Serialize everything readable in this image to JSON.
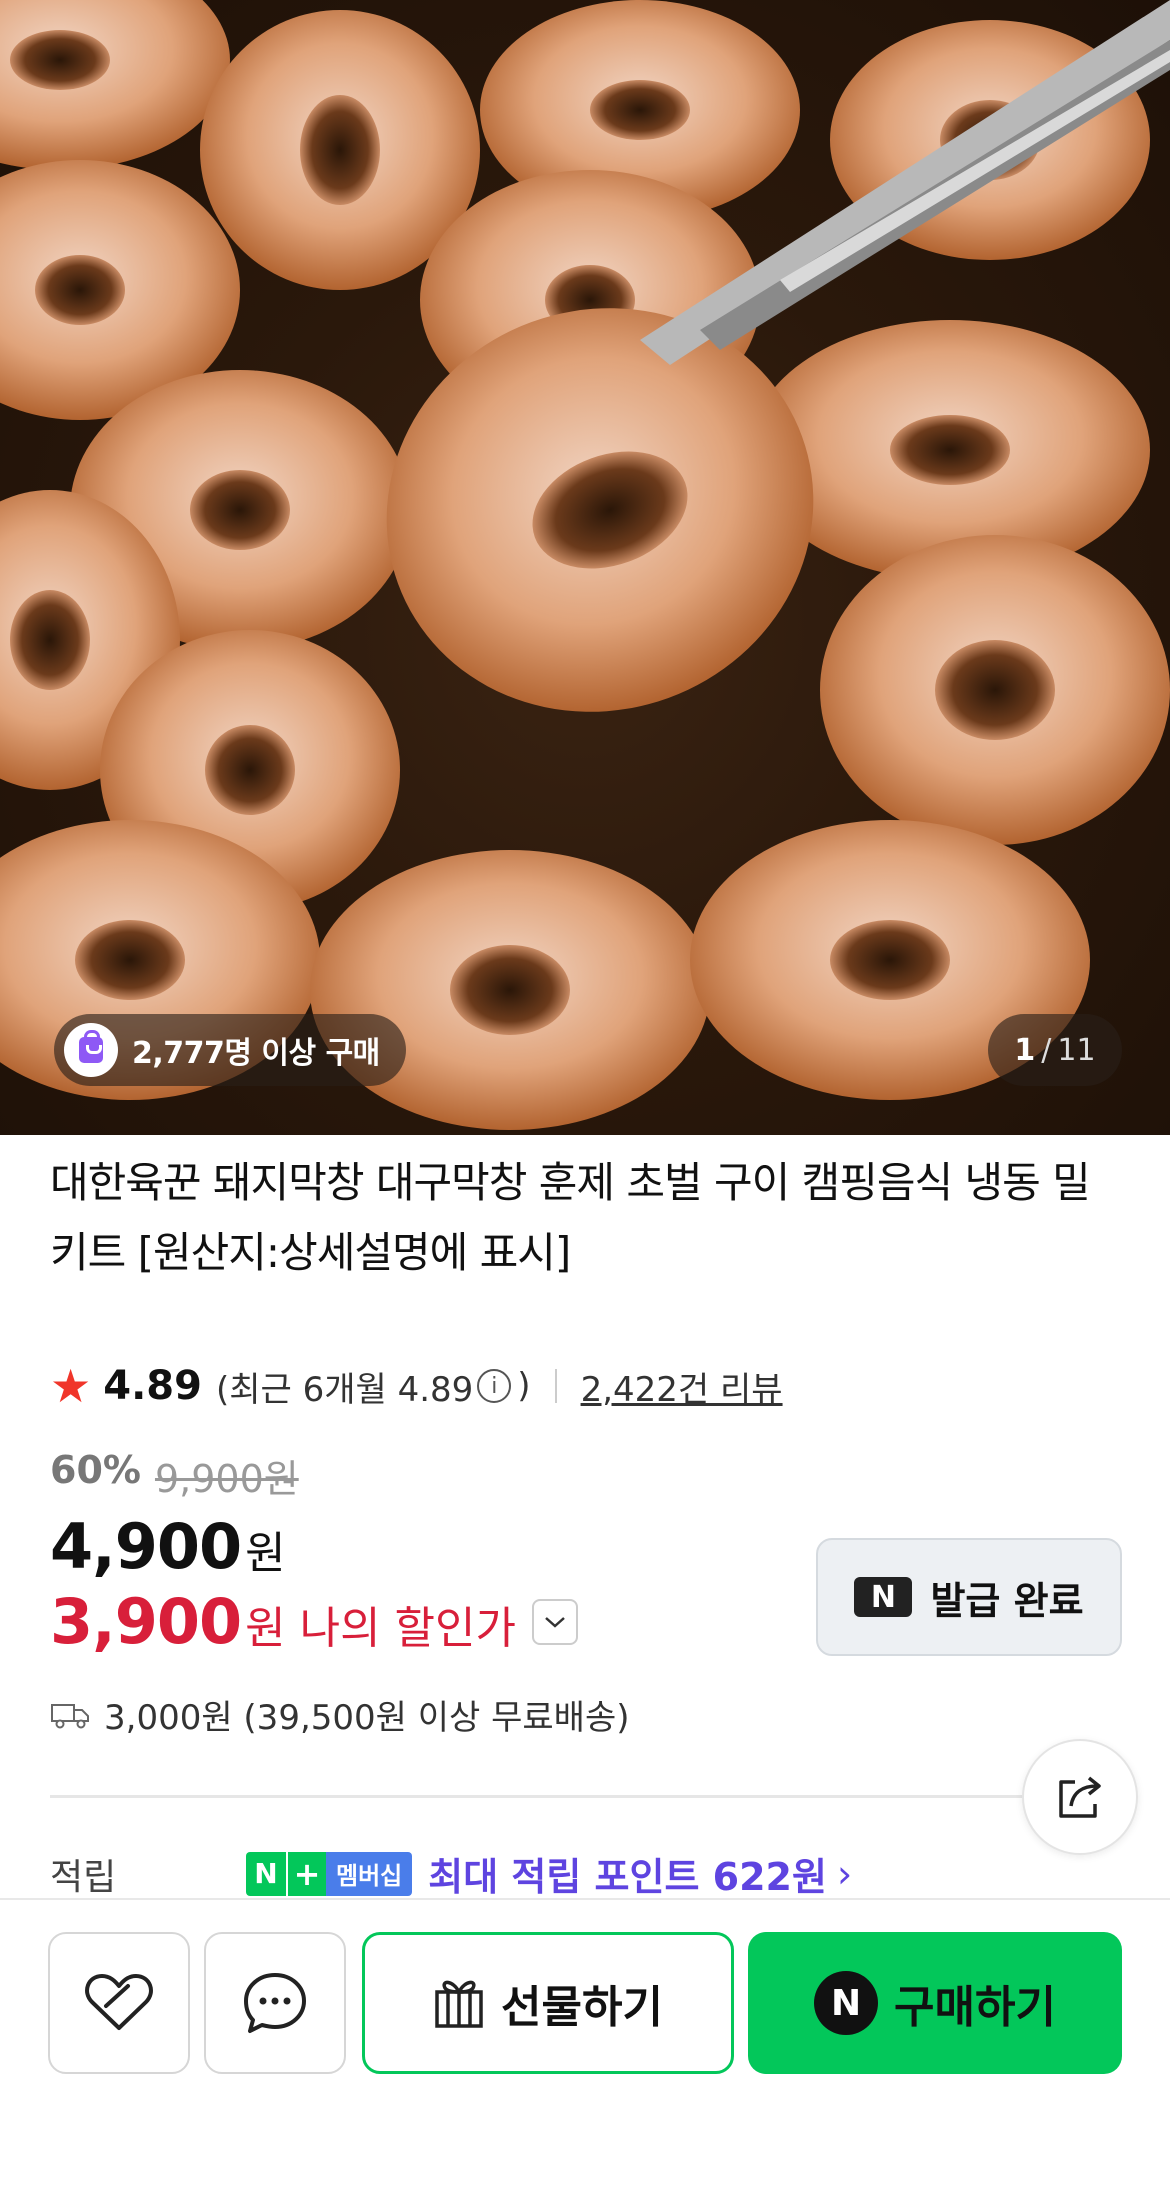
{
  "hero": {
    "image_alt": "smoked pork intestine pieces grilling in a pan with tongs",
    "buyers_badge": "2,777명 이상 구매",
    "page_current": "1",
    "page_total": "11"
  },
  "product": {
    "title": "대한육꾼 돼지막창 대구막창 훈제 초벌 구이 캠핑음식 냉동 밀키트 [원산지:상세설명에 표시]",
    "rating_score": "4.89",
    "rating_recent_prefix": "(최근 6개월 4.89",
    "rating_recent_suffix": ")",
    "review_count": "2,422건 리뷰",
    "discount_rate": "60%",
    "original_price": "9,900원",
    "sale_price": "4,900",
    "sale_unit": "원",
    "my_price": "3,900",
    "my_price_unit": "원",
    "my_price_label": "나의 할인가",
    "coupon_label": "발급 완료",
    "coupon_logo": "N",
    "shipping": "3,000원 (39,500원 이상 무료배송)"
  },
  "points": {
    "label": "적립",
    "badge_n": "N",
    "badge_plus": "+",
    "badge_membership": "멤버십",
    "value": "최대 적립 포인트 622원",
    "arrow": "›"
  },
  "bottom_bar": {
    "gift_label": "선물하기",
    "buy_label": "구매하기",
    "buy_logo": "N"
  },
  "colors": {
    "naver_green": "#03c75a",
    "discount_red": "#d81f3a",
    "points_purple": "#5e44e0",
    "star": "#f0352a"
  },
  "icons": [
    "bag-icon",
    "star-icon",
    "info-icon",
    "chevron-down-icon",
    "truck-icon",
    "share-icon",
    "heart-icon",
    "chat-icon",
    "gift-icon",
    "naver-logo-icon"
  ]
}
